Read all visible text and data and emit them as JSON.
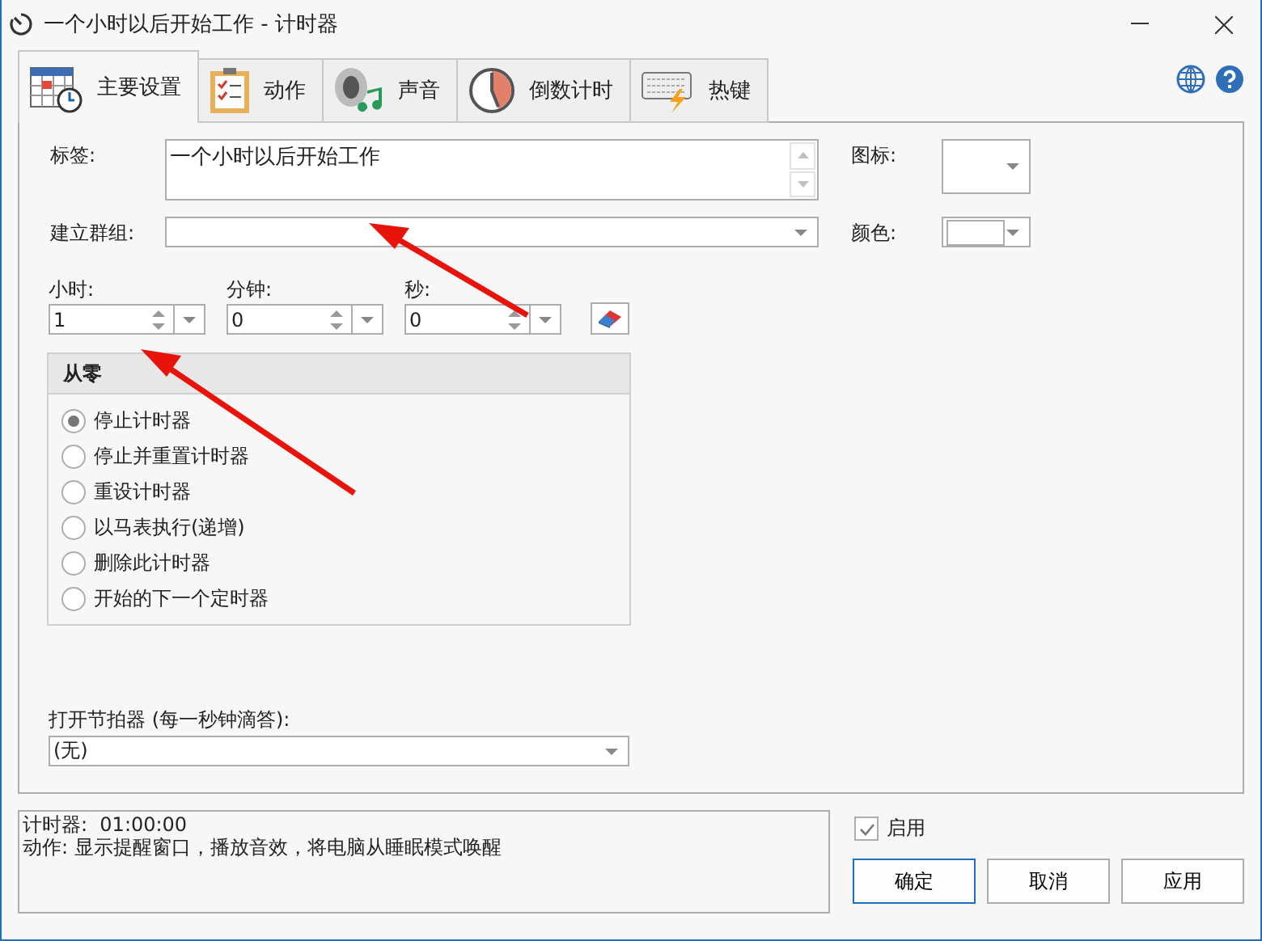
{
  "window": {
    "title": "一个小时以后开始工作 - 计时器"
  },
  "tabs": [
    {
      "label": "主要设置",
      "selected": true,
      "kind": "calendar"
    },
    {
      "label": "动作",
      "selected": false,
      "kind": "clipboard"
    },
    {
      "label": "声音",
      "selected": false,
      "kind": "sound"
    },
    {
      "label": "倒数计时",
      "selected": false,
      "kind": "countdown"
    },
    {
      "label": "热键",
      "selected": false,
      "kind": "keyboard"
    }
  ],
  "form": {
    "label_caption": "标签:",
    "label_value": "一个小时以后开始工作",
    "group_caption": "建立群组:",
    "icon_caption": "图标:",
    "color_caption": "颜色:",
    "time": [
      {
        "caption": "小时:",
        "value": "1"
      },
      {
        "caption": "分钟:",
        "value": "0"
      },
      {
        "caption": "秒:",
        "value": "0"
      }
    ]
  },
  "from_zero": {
    "title": "从零",
    "options": [
      {
        "label": "停止计时器",
        "selected": true
      },
      {
        "label": "停止并重置计时器",
        "selected": false
      },
      {
        "label": "重设计时器",
        "selected": false
      },
      {
        "label": "以马表执行(递增)",
        "selected": false
      },
      {
        "label": "删除此计时器",
        "selected": false
      },
      {
        "label": "开始的下一个定时器",
        "selected": false
      }
    ]
  },
  "metronome": {
    "caption": "打开节拍器 (每一秒钟滴答):",
    "value": "(无)"
  },
  "summary": [
    "计时器:  01:00:00",
    "动作: 显示提醒窗口，播放音效，将电脑从睡眠模式唤醒"
  ],
  "enabled": {
    "label": "启用",
    "checked": true
  },
  "buttons": [
    "确定",
    "取消",
    "应用"
  ]
}
